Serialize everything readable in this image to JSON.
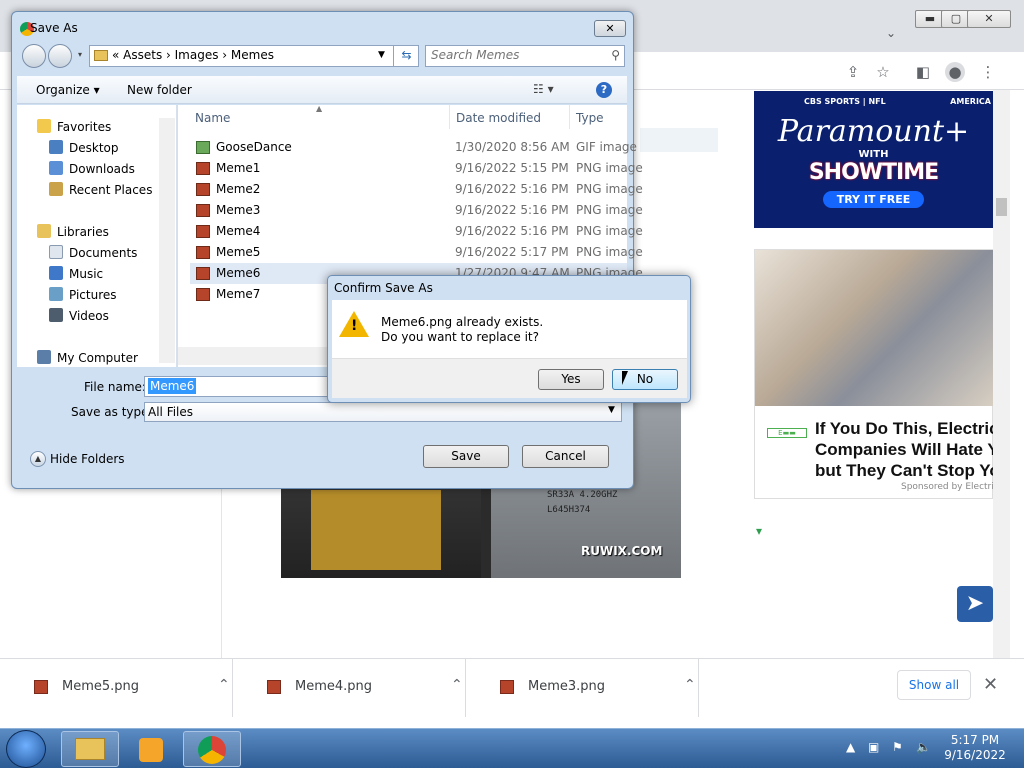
{
  "save_dialog": {
    "title": "Save As",
    "close_glyph": "✕",
    "breadcrumbs": "«   Assets   ›   Images   ›   Memes",
    "search_placeholder": "Search Memes",
    "organize_label": "Organize ▾",
    "new_folder_label": "New folder",
    "help_label": "?",
    "nav": {
      "favorites": "Favorites",
      "desktop": "Desktop",
      "downloads": "Downloads",
      "recent": "Recent Places",
      "libraries": "Libraries",
      "documents": "Documents",
      "music": "Music",
      "pictures": "Pictures",
      "videos": "Videos",
      "computer": "My Computer"
    },
    "columns": {
      "name": "Name",
      "date": "Date modified",
      "type": "Type"
    },
    "files": [
      {
        "name": "GooseDance",
        "date": "1/30/2020 8:56 AM",
        "type": "GIF image"
      },
      {
        "name": "Meme1",
        "date": "9/16/2022 5:15 PM",
        "type": "PNG image"
      },
      {
        "name": "Meme2",
        "date": "9/16/2022 5:16 PM",
        "type": "PNG image"
      },
      {
        "name": "Meme3",
        "date": "9/16/2022 5:16 PM",
        "type": "PNG image"
      },
      {
        "name": "Meme4",
        "date": "9/16/2022 5:16 PM",
        "type": "PNG image"
      },
      {
        "name": "Meme5",
        "date": "9/16/2022 5:17 PM",
        "type": "PNG image"
      },
      {
        "name": "Meme6",
        "date": "1/27/2020 9:47 AM",
        "type": "PNG image"
      },
      {
        "name": "Meme7",
        "date": "",
        "type": ""
      }
    ],
    "file_name_label": "File name:",
    "file_name_value": "Meme6",
    "save_type_label": "Save as type:",
    "save_type_value": "All Files",
    "hide_folders_label": "Hide Folders",
    "save_button": "Save",
    "cancel_button": "Cancel"
  },
  "confirm_dialog": {
    "title": "Confirm Save As",
    "line1": "Meme6.png already exists.",
    "line2": "Do you want to replace it?",
    "yes": "Yes",
    "no": "No"
  },
  "ads": {
    "paramount_top_left": "CBS SPORTS | NFL",
    "paramount_top_right": "AMERICA",
    "paramount_brand": "Paramount+",
    "paramount_with": "WITH",
    "paramount_showtime": "SHOWTIME",
    "paramount_cta": "TRY IT FREE",
    "electric_headline_1": "If You Do This, Electric",
    "electric_headline_2": "Companies Will Hate Y",
    "electric_headline_3": "but They Can't Stop Yo",
    "electric_sponsor": "Sponsored by Electri"
  },
  "cpu_image": {
    "marking_1": "SR33A 4.20GHZ",
    "marking_2": "L645H374",
    "watermark": "RUWIX.COM"
  },
  "downloads": {
    "items": [
      "Meme5.png",
      "Meme4.png",
      "Meme3.png"
    ],
    "show_all": "Show all",
    "close_glyph": "✕"
  },
  "taskbar": {
    "time": "5:17 PM",
    "date": "9/16/2022"
  },
  "colors": {
    "selection": "#3399ff",
    "link_blue": "#1a73e8",
    "dialog_frame": "#cfe0f2"
  }
}
